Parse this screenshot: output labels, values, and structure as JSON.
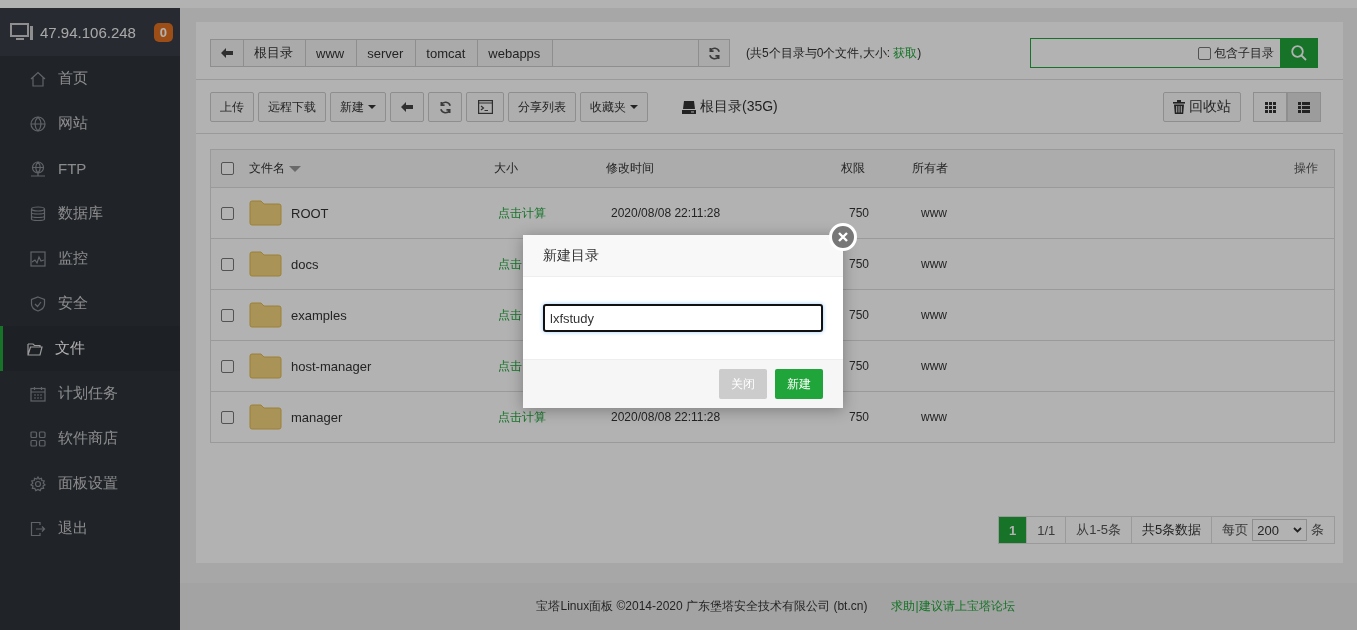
{
  "sidebar": {
    "host": "47.94.106.248",
    "badge": "0",
    "items": [
      {
        "label": "首页",
        "kind": "home",
        "selected": false
      },
      {
        "label": "网站",
        "kind": "globe",
        "selected": false
      },
      {
        "label": "FTP",
        "kind": "ftp",
        "selected": false
      },
      {
        "label": "数据库",
        "kind": "database",
        "selected": false
      },
      {
        "label": "监控",
        "kind": "monitor",
        "selected": false
      },
      {
        "label": "安全",
        "kind": "shield",
        "selected": false
      },
      {
        "label": "文件",
        "kind": "folder",
        "selected": true
      },
      {
        "label": "计划任务",
        "kind": "calendar",
        "selected": false
      },
      {
        "label": "软件商店",
        "kind": "apps",
        "selected": false
      },
      {
        "label": "面板设置",
        "kind": "gear",
        "selected": false
      },
      {
        "label": "退出",
        "kind": "exit",
        "selected": false
      }
    ]
  },
  "breadcrumb": [
    "根目录",
    "www",
    "server",
    "tomcat",
    "webapps"
  ],
  "summary": {
    "prefix": "(共5个目录与0个文件,大小: ",
    "link": "获取",
    "suffix": ")"
  },
  "search": {
    "include_subdirs": {
      "label": "包含子目录",
      "checked": false
    }
  },
  "toolbar": [
    {
      "kind": "text",
      "label": "上传"
    },
    {
      "kind": "text",
      "label": "远程下载"
    },
    {
      "kind": "dropdown",
      "label": "新建"
    },
    {
      "kind": "back"
    },
    {
      "kind": "refresh"
    },
    {
      "kind": "terminal"
    },
    {
      "kind": "text",
      "label": "分享列表"
    },
    {
      "kind": "dropdown",
      "label": "收藏夹"
    }
  ],
  "disk": "根目录(35G)",
  "recycle": "回收站",
  "views": [
    {
      "kind": "grid",
      "selected": false
    },
    {
      "kind": "list",
      "selected": true
    }
  ],
  "table": {
    "all_checked": false,
    "columns": [
      "文件名",
      "大小",
      "修改时间",
      "权限",
      "所有者",
      "操作"
    ],
    "rows": [
      {
        "checked": false,
        "name": "ROOT",
        "size": "点击计算",
        "modified": "2020/08/08 22:11:28",
        "permissions": "750",
        "owner": "www"
      },
      {
        "checked": false,
        "name": "docs",
        "size": "点击",
        "permissions": "750",
        "owner": "www"
      },
      {
        "checked": false,
        "name": "examples",
        "size": "点击",
        "permissions": "750",
        "owner": "www"
      },
      {
        "checked": false,
        "name": "host-manager",
        "size": "点击",
        "permissions": "750",
        "owner": "www"
      },
      {
        "checked": false,
        "name": "manager",
        "size": "点击计算",
        "modified": "2020/08/08 22:11:28",
        "permissions": "750",
        "owner": "www"
      }
    ]
  },
  "pagination": {
    "pages": [
      {
        "label": "1",
        "selected": true
      }
    ],
    "page_count": "1/1",
    "range": "从1-5条",
    "total": "共5条数据",
    "per_page_label": "每页",
    "per_page": "200",
    "per_page_unit": "条"
  },
  "footer": {
    "copyright": "宝塔Linux面板 ©2014-2020 广东堡塔安全技术有限公司 (bt.cn)",
    "link": "求助|建议请上宝塔论坛"
  },
  "dialog": {
    "title": "新建目录",
    "value": "lxfstudy",
    "buttons": [
      {
        "kind": "secondary",
        "label": "关闭"
      },
      {
        "kind": "primary",
        "label": "新建"
      }
    ]
  }
}
